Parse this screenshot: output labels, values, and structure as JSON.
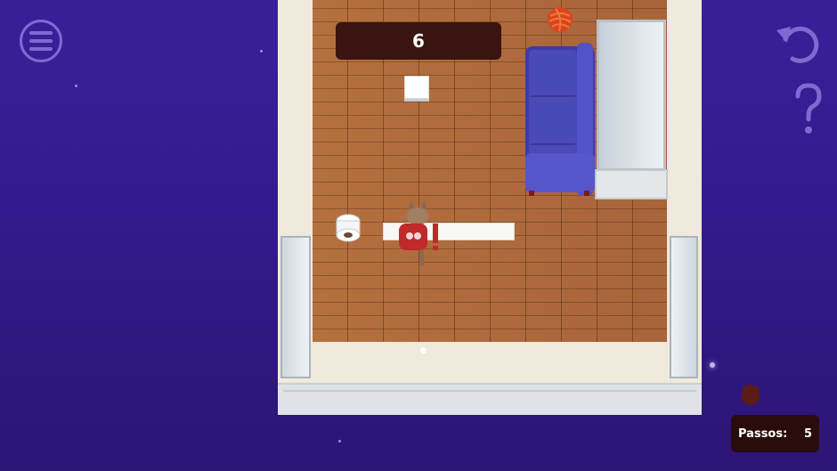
{
  "hud": {
    "counter": "6",
    "steps_label": "Passos:",
    "steps_value": "5"
  },
  "controls": {
    "menu_icon": "hamburger-menu-icon",
    "undo_icon": "undo-arrow-icon",
    "help_icon": "question-mark-icon"
  },
  "colors": {
    "background": "#341a8c",
    "control_accent": "#7d6bd1",
    "counter_bg": "#3a1410",
    "steps_bg": "#2a0c0a",
    "sofa": "#4a49b8",
    "cat_sweater": "#c02a2a"
  }
}
